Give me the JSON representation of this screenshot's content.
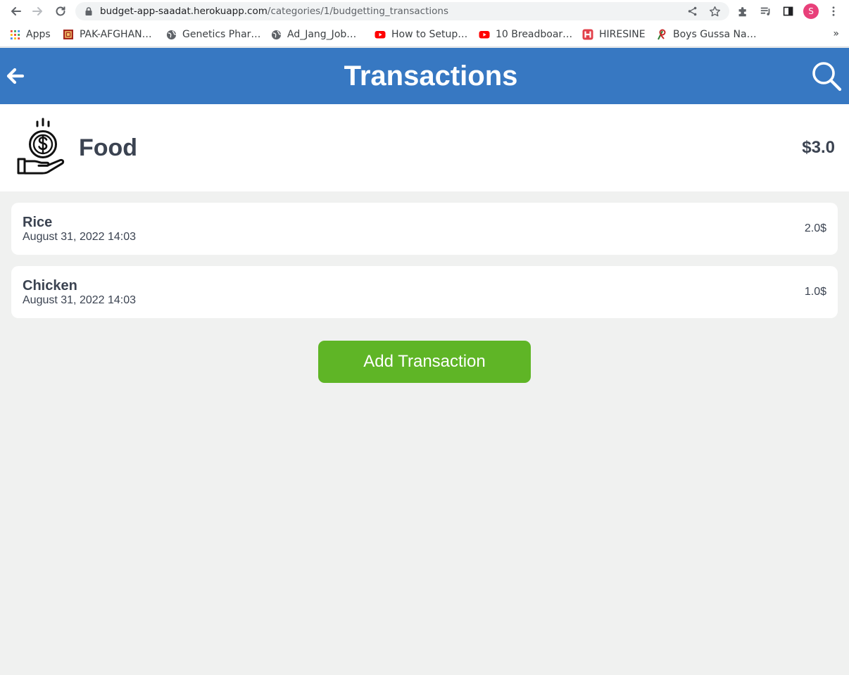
{
  "browser": {
    "url_host": "budget-app-saadat.herokuapp.com",
    "url_path": "/categories/1/budgetting_transactions",
    "profile_initial": "S",
    "bookmarks": [
      {
        "label": "Apps",
        "icon": "apps-grid-icon"
      },
      {
        "label": "PAK-AFGHAN…",
        "icon": "bookmark-favicon-icon"
      },
      {
        "label": "Genetics Phar…",
        "icon": "globe-icon"
      },
      {
        "label": "Ad_Jang_Job…",
        "icon": "globe-icon"
      },
      {
        "label": "How to Setup…",
        "icon": "youtube-icon"
      },
      {
        "label": "10 Breadboar…",
        "icon": "youtube-icon"
      },
      {
        "label": "HIRESINE",
        "icon": "hiresine-icon"
      },
      {
        "label": "Boys Gussa Na…",
        "icon": "bookmark-favicon-icon"
      }
    ],
    "bookmarks_overflow": "»"
  },
  "header": {
    "title": "Transactions",
    "color": "#3778c2"
  },
  "category": {
    "name": "Food",
    "total": "$3.0",
    "icon": "money-hand-icon"
  },
  "transactions": [
    {
      "name": "Rice",
      "date": "August 31, 2022 14:03",
      "amount": "2.0$"
    },
    {
      "name": "Chicken",
      "date": "August 31, 2022 14:03",
      "amount": "1.0$"
    }
  ],
  "actions": {
    "add_label": "Add Transaction",
    "add_color": "#5fb526"
  }
}
